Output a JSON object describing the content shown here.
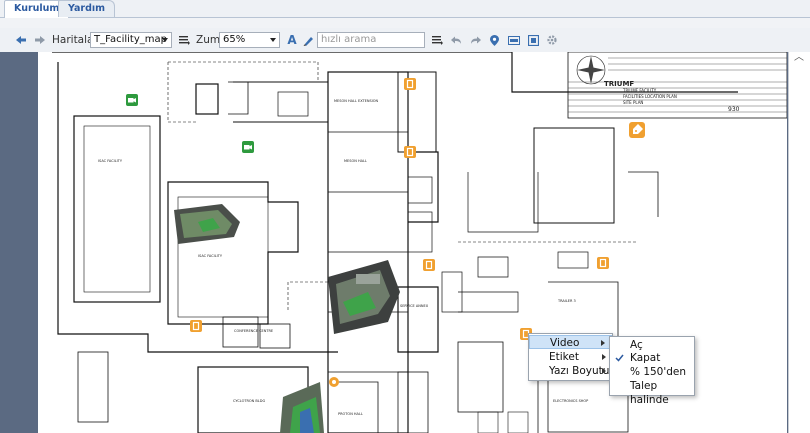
{
  "tabs": [
    {
      "label": "Kurulum",
      "active": true
    },
    {
      "label": "Yardım",
      "active": false
    }
  ],
  "toolbar": {
    "maps_label": "Haritalar:",
    "map_value": "T_Facility_map",
    "zoom_label": "Zum:",
    "zoom_value": "65%",
    "search_placeholder": "hızlı arama"
  },
  "context_menu": {
    "items": [
      {
        "label": "Video",
        "has_submenu": true,
        "highlighted": true
      },
      {
        "label": "Etiket",
        "has_submenu": true,
        "highlighted": false
      },
      {
        "label": "Yazı Boyutu",
        "has_submenu": true,
        "highlighted": false
      }
    ]
  },
  "video_submenu": {
    "items": [
      {
        "label": "Aç",
        "checked": false
      },
      {
        "label": "Kapat",
        "checked": true
      },
      {
        "label": "% 150'den",
        "checked": false
      },
      {
        "label": "Talep halinde",
        "checked": false
      }
    ]
  },
  "map": {
    "title_block": {
      "brand": "TRIUMF",
      "doc_title_1": "TRIUMF FACILITY",
      "doc_title_2": "FACILITIES LOCATION PLAN",
      "doc_title_3": "SITE PLAN",
      "drawing_number": "930"
    },
    "buildings": [
      "MESON HALL EXTENSION",
      "MESON HALL",
      "ISAC FACILITY",
      "ISAC FACILITY",
      "CONFERENCE CENTRE",
      "CYCLOTRON BLDG",
      "SERVICE ANNEX",
      "PROTON HALL",
      "TRAILER 3",
      "ELECTRONICS SHOP"
    ],
    "colors": {
      "camera_badge": "#2e9a3e",
      "alarm_badge": "#f0a030",
      "floor_background": "#5b6a82",
      "accent": "#2c5aa0"
    }
  }
}
